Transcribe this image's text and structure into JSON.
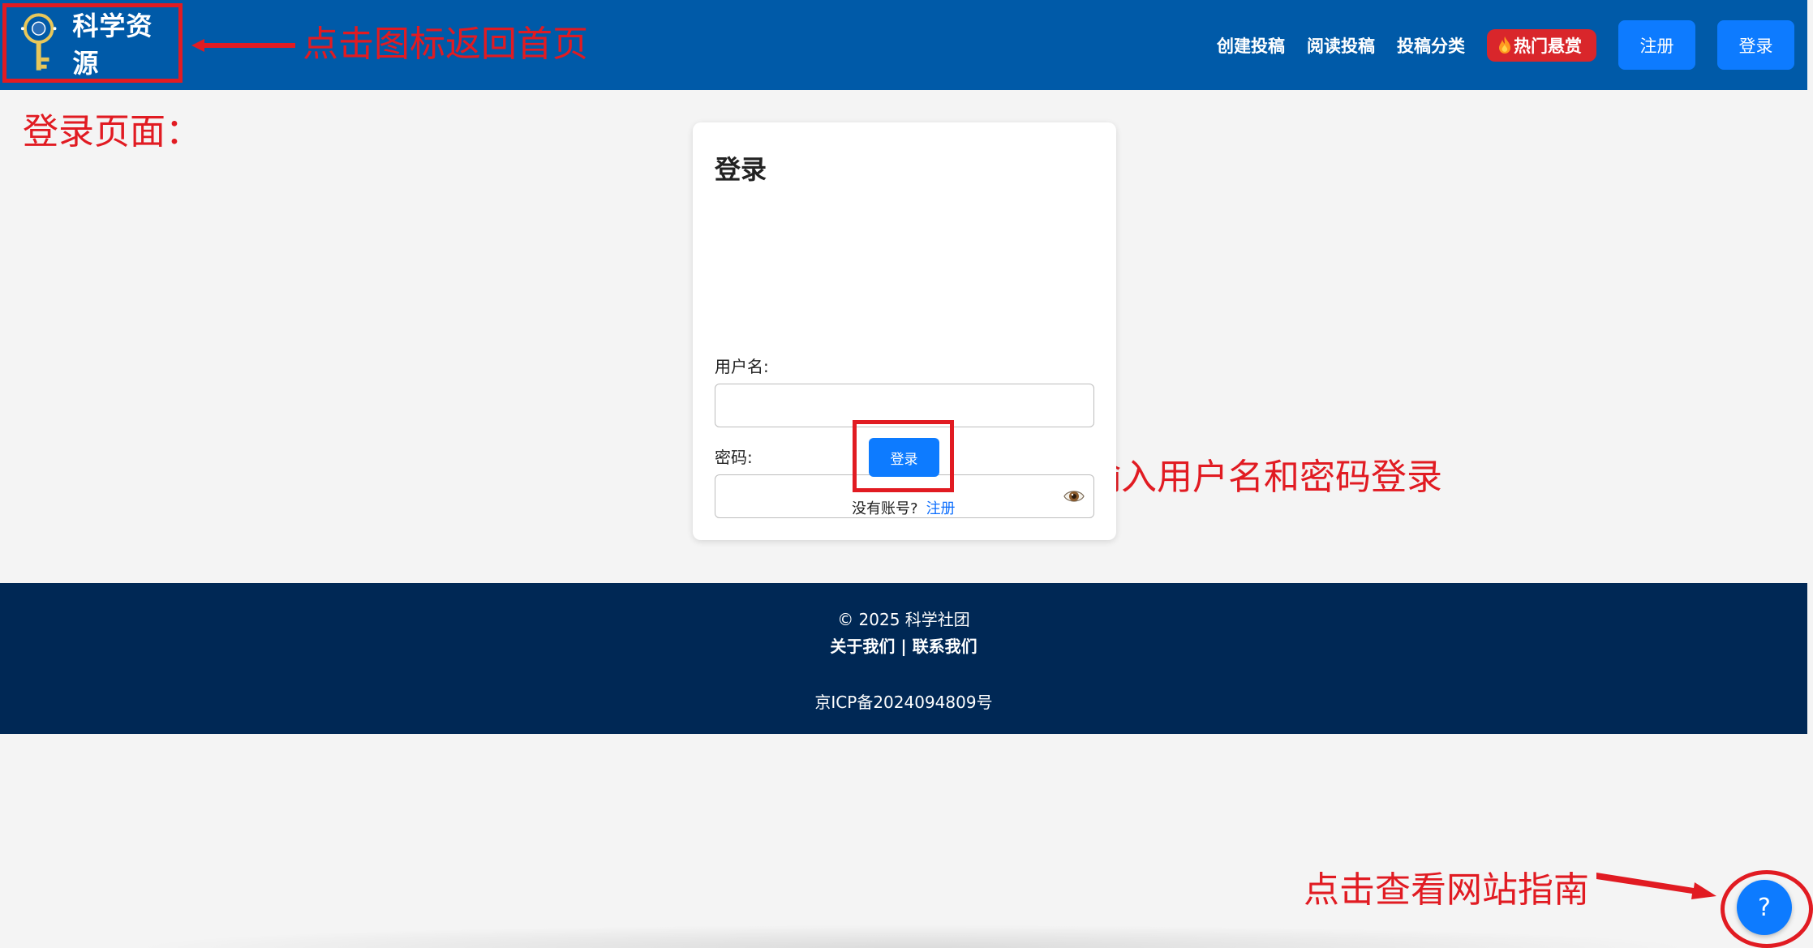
{
  "header": {
    "logo_text": "科学资源",
    "nav": [
      "创建投稿",
      "阅读投稿",
      "投稿分类"
    ],
    "hot_label": "热门悬赏",
    "register_label": "注册",
    "login_label": "登录"
  },
  "annotations": {
    "home": "点击图标返回首页",
    "page": "登录页面：",
    "login": "输入用户名和密码登录",
    "guide": "点击查看网站指南"
  },
  "login_form": {
    "title": "登录",
    "username_label": "用户名:",
    "username_value": "",
    "password_label": "密码:",
    "password_value": "",
    "submit_label": "登录",
    "no_account_text": "没有账号?",
    "register_link": "注册"
  },
  "footer": {
    "copyright": "© 2025 科学社团",
    "links": "关于我们 | 联系我们",
    "icp": "京ICP备2024094809号"
  },
  "help": {
    "label": "?"
  },
  "colors": {
    "header_bg": "#005aa8",
    "footer_bg": "#002855",
    "accent": "#0d7bff",
    "hot": "#d9262b",
    "annotation": "#e11b22"
  }
}
